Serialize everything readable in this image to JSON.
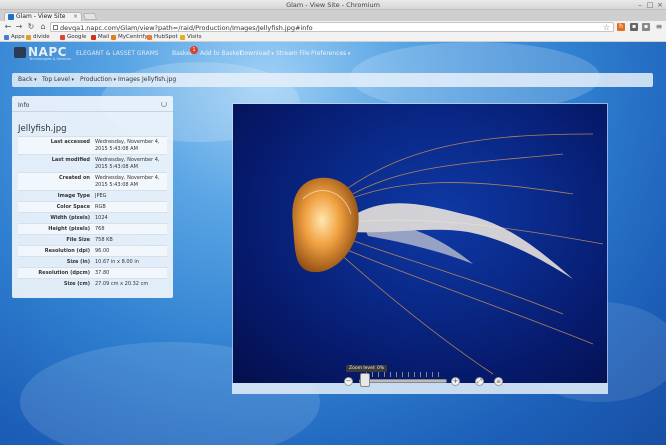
{
  "window": {
    "title": "Glam - View Site - Chromium"
  },
  "tab": {
    "label": "Glam - View Site"
  },
  "address": {
    "url": "devqa1.napc.com/Glam/view?path=/raid/Production/Images/Jellyfish.jpg#info"
  },
  "bookmarks": [
    {
      "label": "Apps",
      "color": "#4a7bd0"
    },
    {
      "label": "divide",
      "color": "#e0a020"
    },
    {
      "label": "Google",
      "color": "#dd4433"
    },
    {
      "label": "Mail",
      "color": "#cc3322"
    },
    {
      "label": "MyCentrify",
      "color": "#e08020"
    },
    {
      "label": "HubSpot",
      "color": "#f07a30"
    },
    {
      "label": "Visits",
      "color": "#e0b020"
    }
  ],
  "app": {
    "brand": "NAPC",
    "tagline": "Technologies & Services",
    "name": "ELEGANT & LASSET GRAMS",
    "nav": {
      "basket": "Basket",
      "basket_count": "1",
      "add_to_basket": "Add to Basket",
      "download": "Download",
      "stream_file": "Stream File",
      "preferences": "Preferences"
    }
  },
  "breadcrumb": {
    "back": "Back",
    "top_level": "Top Level",
    "production": "Production",
    "images": "Images",
    "current": "Jellyfish.jpg"
  },
  "info": {
    "header": "Info",
    "title": "Jellyfish.jpg",
    "rows": [
      {
        "key": "Last accessed",
        "value": "Wednesday, November 4, 2015 5:43:08 AM"
      },
      {
        "key": "Last modified",
        "value": "Wednesday, November 4, 2015 5:43:08 AM"
      },
      {
        "key": "Created on",
        "value": "Wednesday, November 4, 2015 5:43:08 AM"
      },
      {
        "key": "Image Type",
        "value": "JPEG"
      },
      {
        "key": "Color Space",
        "value": "RGB"
      },
      {
        "key": "Width (pixels)",
        "value": "1024"
      },
      {
        "key": "Height (pixels)",
        "value": "768"
      },
      {
        "key": "File Size",
        "value": "758 KB"
      },
      {
        "key": "Resolution (dpi)",
        "value": "96.00"
      },
      {
        "key": "Size (in)",
        "value": "10.67 in x 8.00 in"
      },
      {
        "key": "Resolution (dpcm)",
        "value": "37.80"
      },
      {
        "key": "Size (cm)",
        "value": "27.09 cm x 20.32 cm"
      }
    ]
  },
  "viewer": {
    "zoom_tip": "Zoom level: 0%",
    "zoom_level": 0
  }
}
